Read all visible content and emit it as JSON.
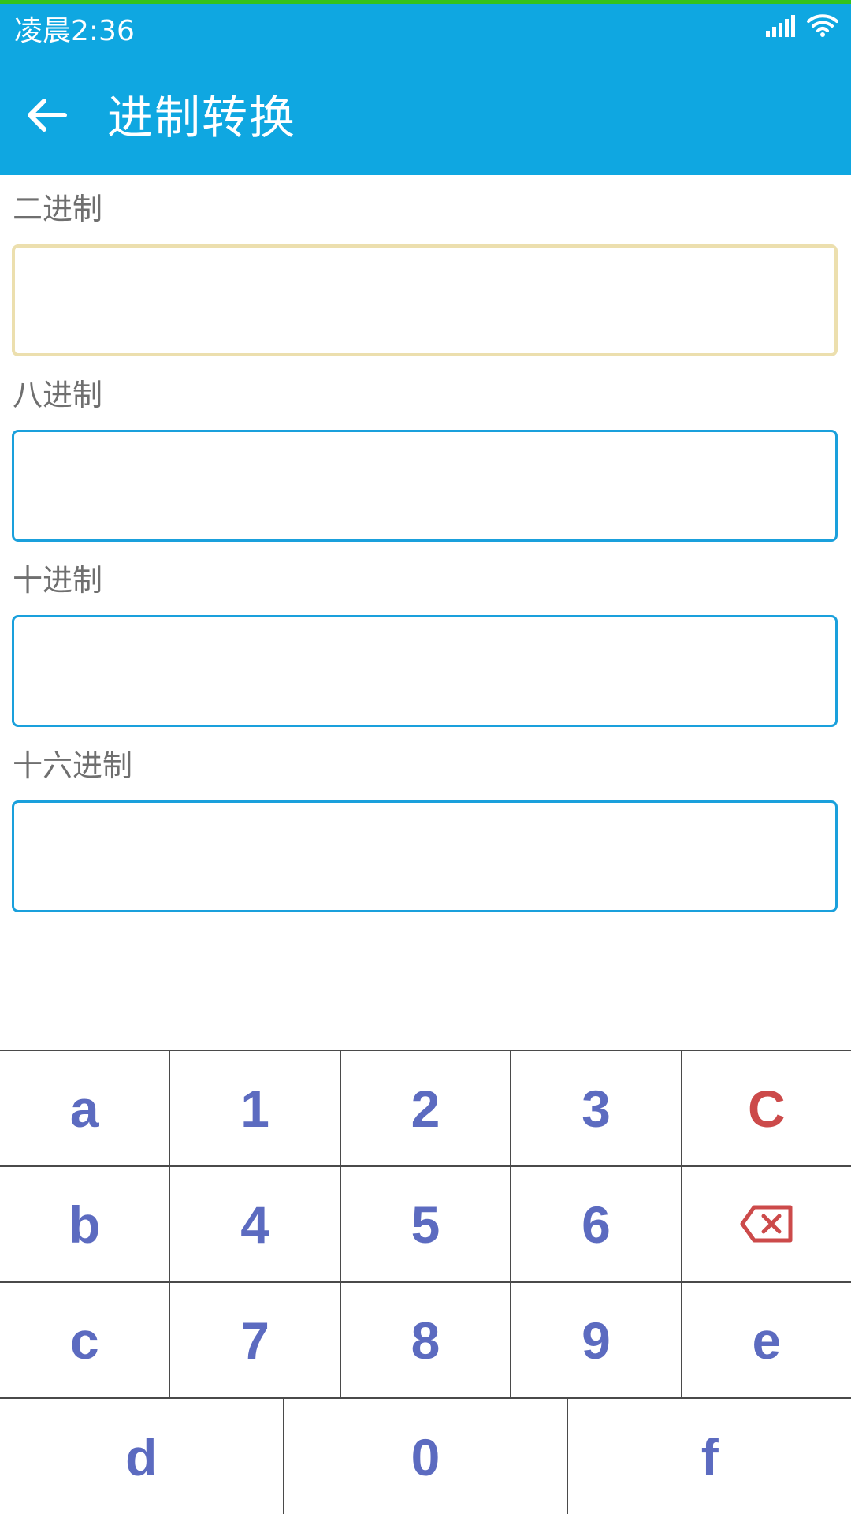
{
  "status_bar": {
    "time": "凌晨2:36",
    "icons": [
      "signal-icon",
      "wifi-icon"
    ]
  },
  "app_bar": {
    "title": "进制转换",
    "back_icon": "back-arrow-icon"
  },
  "fields": [
    {
      "label": "二进制",
      "value": "",
      "focused": true
    },
    {
      "label": "八进制",
      "value": ""
    },
    {
      "label": "十进制",
      "value": ""
    },
    {
      "label": "十六进制",
      "value": ""
    }
  ],
  "keypad": {
    "rows": [
      [
        "a",
        "1",
        "2",
        "3",
        "C"
      ],
      [
        "b",
        "4",
        "5",
        "6",
        ""
      ],
      [
        "c",
        "7",
        "8",
        "9",
        "e"
      ],
      [
        "d",
        "0",
        "f"
      ]
    ],
    "backspace_icon": "backspace-icon"
  },
  "colors": {
    "accent": "#0fa7e1",
    "top_line": "#34c21b",
    "focus_border": "#ecdfae",
    "field_border": "#1aa0dc",
    "key_text": "#5c6bc0",
    "key_danger": "#cc4a4a"
  }
}
